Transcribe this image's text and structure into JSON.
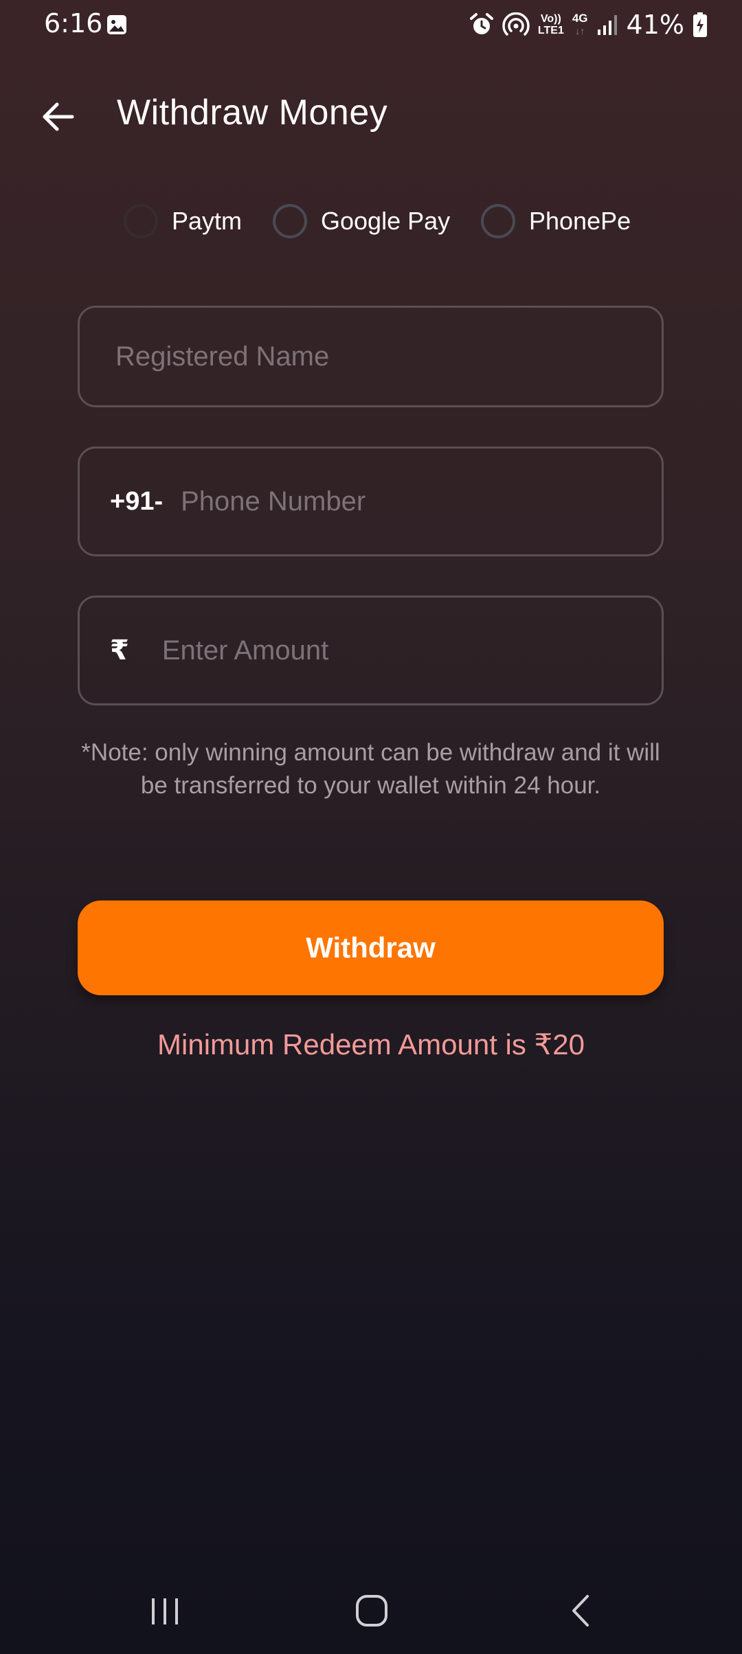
{
  "status_bar": {
    "time": "6:16",
    "volte_line1": "Vo))",
    "volte_line2": "LTE1",
    "network": "4G",
    "network_arrows": "↓↑",
    "battery_percent": "41%",
    "icons": [
      "gallery-icon",
      "alarm-icon",
      "hotspot-icon",
      "signal-icon",
      "battery-charging-icon"
    ]
  },
  "header": {
    "title": "Withdraw Money",
    "back_icon": "arrow-left-icon"
  },
  "payment_methods": {
    "options": [
      {
        "label": "Paytm",
        "selected": false
      },
      {
        "label": "Google Pay",
        "selected": false
      },
      {
        "label": "PhonePe",
        "selected": false
      }
    ]
  },
  "form": {
    "name_placeholder": "Registered Name",
    "name_value": "",
    "phone_prefix": "+91-",
    "phone_placeholder": "Phone Number",
    "phone_value": "",
    "currency_symbol": "₹",
    "amount_placeholder": "Enter Amount",
    "amount_value": ""
  },
  "note": "*Note: only winning amount can be withdraw and it will be transferred to your wallet within 24 hour.",
  "withdraw_button": {
    "label": "Withdraw",
    "color": "#fe7501"
  },
  "minimum_note": "Minimum Redeem Amount is ₹20",
  "colors": {
    "accent": "#fe7501",
    "warning_text": "#f39a98"
  },
  "nav_bar": {
    "icons": [
      "recent-apps-icon",
      "home-icon",
      "back-icon"
    ]
  }
}
